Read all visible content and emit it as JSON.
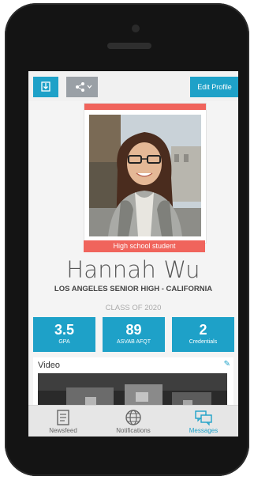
{
  "toolbar": {
    "edit_label": "Edit Profile"
  },
  "profile": {
    "badge": "High school student",
    "name": "Hannah Wu",
    "school": "LOS ANGELES SENIOR HIGH - CALIFORNIA",
    "class_year": "CLASS OF 2020"
  },
  "stats": [
    {
      "value": "3.5",
      "label": "GPA"
    },
    {
      "value": "89",
      "label": "ASVAB AFQT"
    },
    {
      "value": "2",
      "label": "Credentials"
    }
  ],
  "video": {
    "title": "Video"
  },
  "tabs": [
    {
      "label": "Newsfeed",
      "icon": "newsfeed-icon"
    },
    {
      "label": "Notifications",
      "icon": "globe-icon"
    },
    {
      "label": "Messages",
      "icon": "chat-bubbles-icon",
      "active": true
    }
  ],
  "colors": {
    "accent": "#1ea1c8",
    "coral": "#f0645c",
    "phone": "#141414"
  }
}
